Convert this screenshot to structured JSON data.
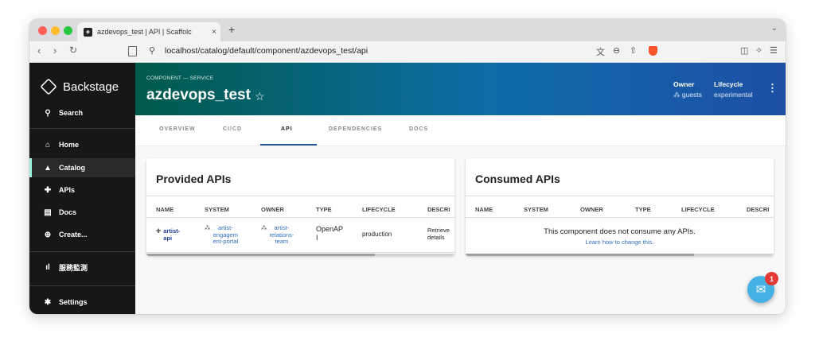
{
  "browser": {
    "tab_title": "azdevops_test | API | Scaffolc",
    "tab_close": "×",
    "new_tab": "+",
    "tab_menu": "⌄",
    "url": "localhost/catalog/default/component/azdevops_test/api",
    "colors": {
      "close": "#ff5f57",
      "minimize": "#febc2e",
      "maximize": "#28c840"
    }
  },
  "sidebar": {
    "brand": "Backstage",
    "search": "Search",
    "items": [
      {
        "label": "Home",
        "icon": "home-icon"
      },
      {
        "label": "Catalog",
        "icon": "catalog-icon",
        "active": true
      },
      {
        "label": "APIs",
        "icon": "puzzle-icon"
      },
      {
        "label": "Docs",
        "icon": "docs-icon"
      },
      {
        "label": "Create...",
        "icon": "plus-circle-icon"
      }
    ],
    "extra": "服務監測",
    "settings": "Settings",
    "accent": "#9bf0e1"
  },
  "header": {
    "breadcrumb": "COMPONENT — SERVICE",
    "title": "azdevops_test",
    "owner_label": "Owner",
    "owner_value": "guests",
    "lifecycle_label": "Lifecycle",
    "lifecycle_value": "experimental"
  },
  "tabs": [
    "OVERVIEW",
    "CI/CD",
    "API",
    "DEPENDENCIES",
    "DOCS"
  ],
  "active_tab": "API",
  "provided": {
    "title": "Provided APIs",
    "columns": [
      "NAME",
      "SYSTEM",
      "OWNER",
      "TYPE",
      "LIFECYCLE",
      "DESCRI"
    ],
    "row": {
      "name": "artist-\napi",
      "system": "artist-\nengagem\nent-portal",
      "owner": "artist-\nrelations-\nteam",
      "type": "OpenAP\nI",
      "lifecycle": "production",
      "description": "Retrieve\ndetails"
    }
  },
  "consumed": {
    "title": "Consumed APIs",
    "columns": [
      "NAME",
      "SYSTEM",
      "OWNER",
      "TYPE",
      "LIFECYCLE",
      "DESCRI"
    ],
    "empty": "This component does not consume any APIs.",
    "link": "Learn how to change this."
  },
  "support": {
    "badge": "1"
  }
}
